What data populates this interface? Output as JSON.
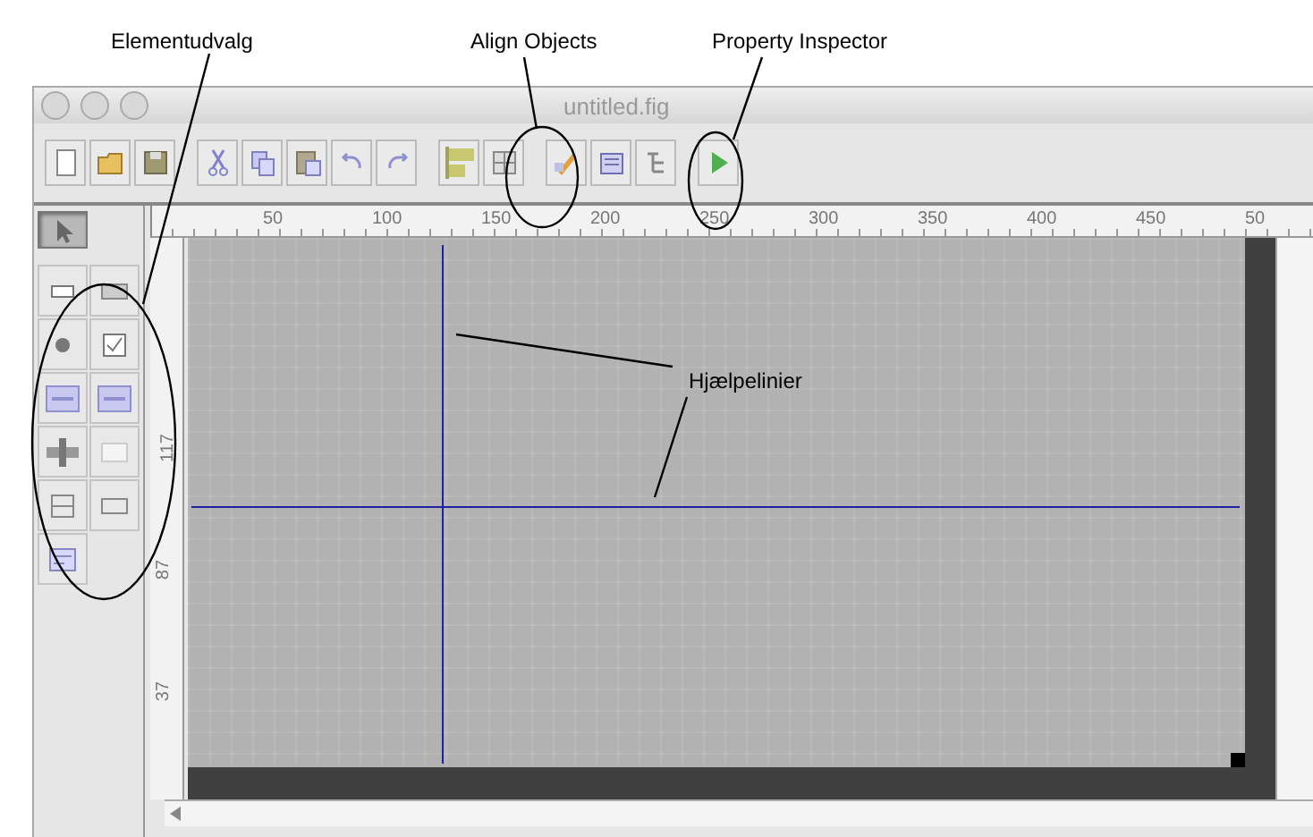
{
  "annotations": [
    {
      "label": "Elementudvalg"
    },
    {
      "label": "Align Objects"
    },
    {
      "label": "Property Inspector"
    },
    {
      "label": "Hjælpelinier"
    }
  ],
  "window": {
    "title": "untitled.fig"
  },
  "palette": {
    "tools": [
      {
        "selected": true
      },
      {
        "selected": false
      },
      {
        "selected": false
      },
      {
        "selected": false
      },
      {
        "selected": false
      },
      {
        "selected": false
      },
      {
        "selected": false
      },
      {
        "selected": false
      },
      {
        "selected": false
      },
      {
        "selected": false
      },
      {
        "selected": false
      },
      {
        "selected": false
      }
    ]
  },
  "rulers": {
    "horizontal": [
      "50",
      "100",
      "150",
      "200",
      "250",
      "300",
      "350",
      "400",
      "450",
      "50"
    ],
    "vertical": [
      "117",
      "87",
      "37"
    ]
  }
}
